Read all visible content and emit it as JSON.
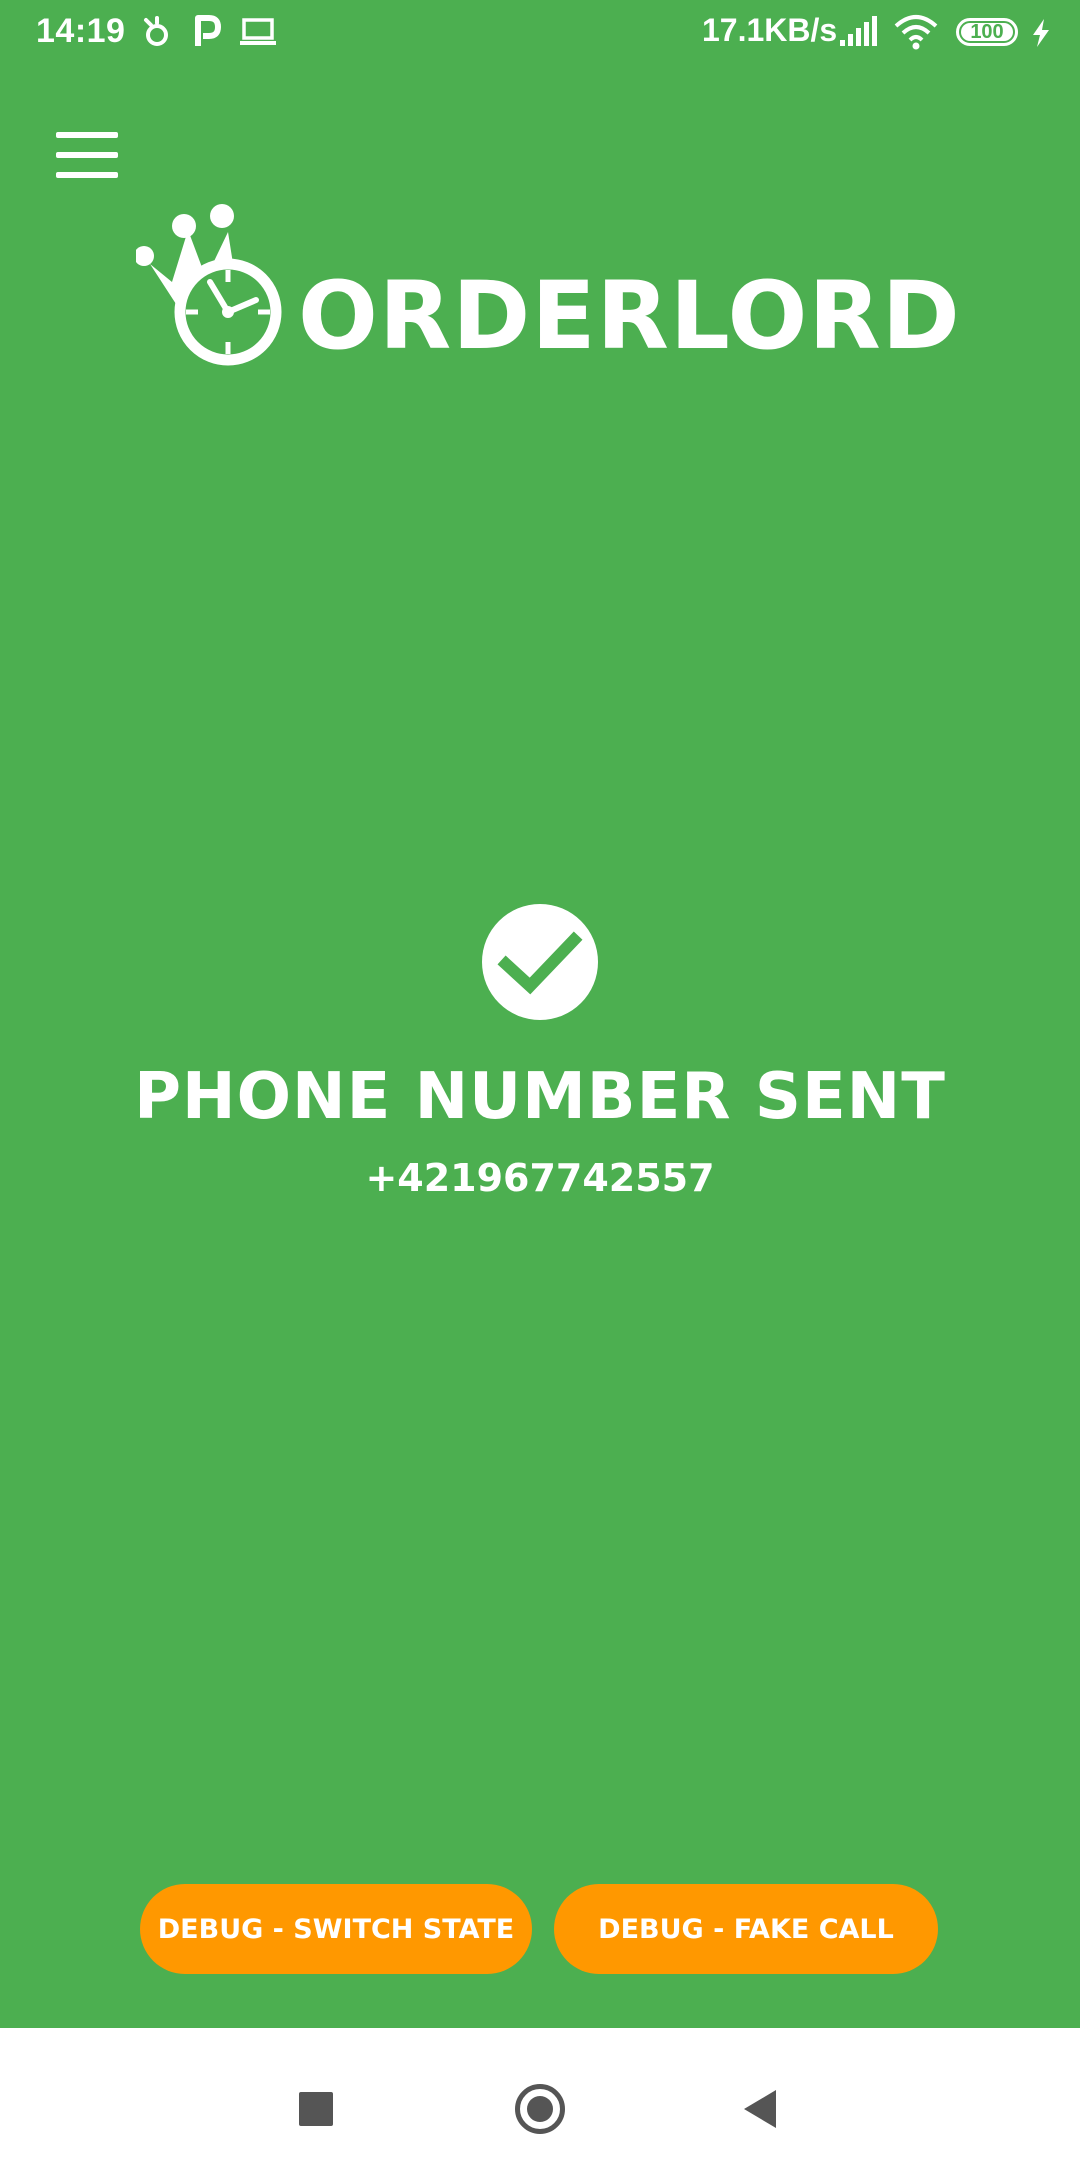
{
  "status_bar": {
    "time": "14:19",
    "network_speed": "17.1KB/s",
    "battery_level": "100",
    "icons": [
      "alarm-icon",
      "parking-icon",
      "laptop-icon",
      "signal-icon",
      "wifi-icon",
      "battery-icon",
      "charging-icon"
    ]
  },
  "header": {
    "menu_icon": "hamburger-menu-icon",
    "logo_text": "ORDERLORD",
    "logo_icon": "crown-clock-icon"
  },
  "main": {
    "status_icon": "check-icon",
    "title": "PHONE NUMBER SENT",
    "phone_number": "+421967742557"
  },
  "actions": {
    "switch_state_label": "DEBUG - SWITCH STATE",
    "fake_call_label": "DEBUG - FAKE CALL"
  },
  "navigation": {
    "recents": "recents-icon",
    "home": "home-icon",
    "back": "back-icon"
  },
  "colors": {
    "background": "#4caf50",
    "accent_button": "#ff9800",
    "text": "#ffffff",
    "nav_bar": "#ffffff"
  }
}
